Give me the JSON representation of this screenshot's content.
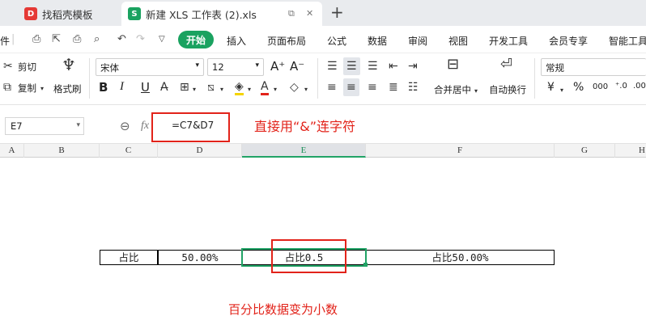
{
  "tabs": [
    {
      "title": "找稻壳模板",
      "logo": "D"
    },
    {
      "title": "新建 XLS 工作表 (2).xls",
      "logo": "S"
    }
  ],
  "tab_controls": {
    "pin": "⧉",
    "close": "✕",
    "add": "+"
  },
  "menu": {
    "lead": "件",
    "items": [
      "开始",
      "插入",
      "页面布局",
      "公式",
      "数据",
      "审阅",
      "视图",
      "开发工具",
      "会员专享",
      "智能工具"
    ]
  },
  "ribbon": {
    "cut": "剪切",
    "copy": "复制",
    "format_painter": "格式刷",
    "font_name": "宋体",
    "font_size": "12",
    "font_grow": "A⁺",
    "font_shrink": "A⁻",
    "bold": "B",
    "italic": "I",
    "underline": "U",
    "merge_center": "合并居中",
    "wrap_text": "自动换行",
    "number_format": "常规",
    "currency": "¥",
    "percent": "%",
    "thousands": "000",
    "dec_add": "⁺.0",
    "dec_remove": ".00"
  },
  "formula_bar": {
    "cell_ref": "E7",
    "fx": "fx",
    "formula": "=C7&D7"
  },
  "columns": [
    "A",
    "B",
    "C",
    "D",
    "E",
    "F",
    "G",
    "H"
  ],
  "row": {
    "C": "占比",
    "D": "50.00%",
    "E": "占比0.5",
    "F": "占比50.00%"
  },
  "annotations": {
    "top": "直接用“&”连字符",
    "bottom": "百分比数据变为小数"
  },
  "colors": {
    "accent": "#1aa260",
    "annotation": "#e2231a",
    "selection": "#21a366"
  }
}
